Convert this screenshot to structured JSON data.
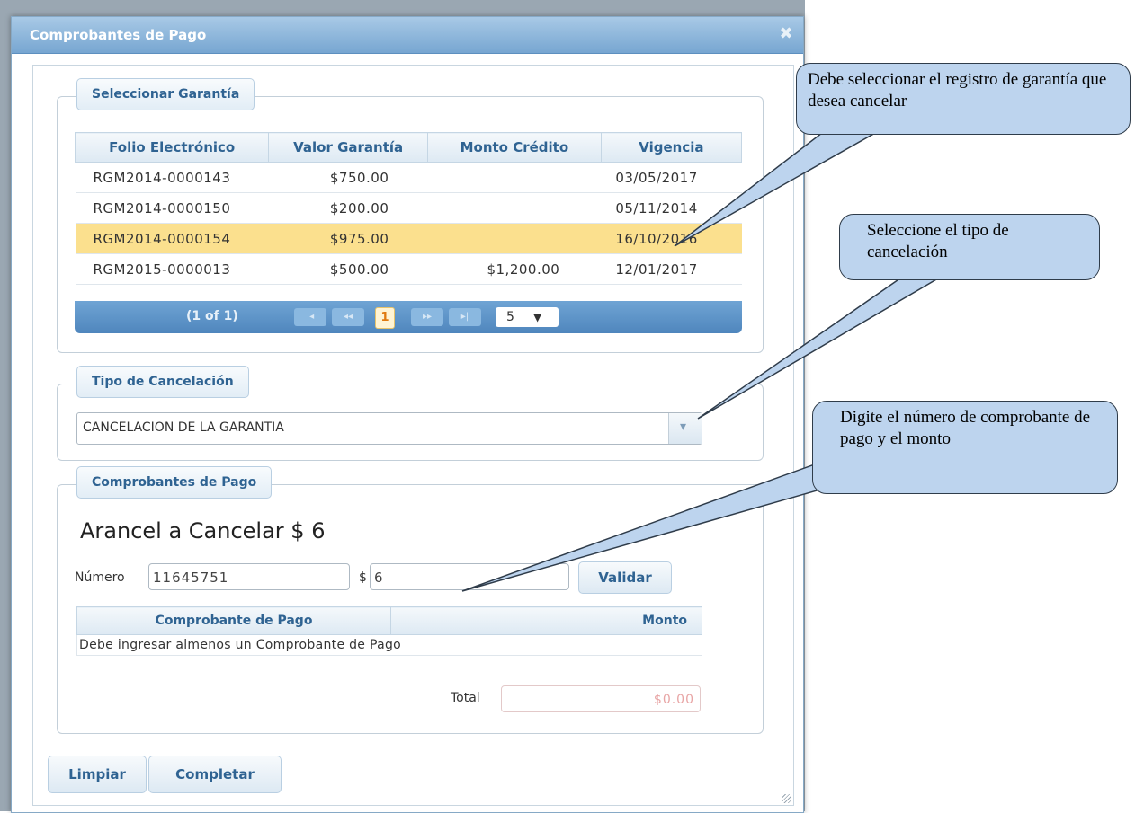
{
  "dialog": {
    "title": "Comprobantes de Pago",
    "close_glyph": "✖"
  },
  "garantia": {
    "legend": "Seleccionar Garantía",
    "columns": [
      "Folio Electrónico",
      "Valor Garantía",
      "Monto Crédito",
      "Vigencia"
    ],
    "rows": [
      {
        "folio": "RGM2014-0000143",
        "valor": "$750.00",
        "monto": "",
        "vigencia": "03/05/2017",
        "selected": false
      },
      {
        "folio": "RGM2014-0000150",
        "valor": "$200.00",
        "monto": "",
        "vigencia": "05/11/2014",
        "selected": false
      },
      {
        "folio": "RGM2014-0000154",
        "valor": "$975.00",
        "monto": "",
        "vigencia": "16/10/2016",
        "selected": true
      },
      {
        "folio": "RGM2015-0000013",
        "valor": "$500.00",
        "monto": "$1,200.00",
        "vigencia": "12/01/2017",
        "selected": false
      }
    ],
    "pager": {
      "info": "(1 of 1)",
      "first": "|◂",
      "prev": "◂◂",
      "current_page": "1",
      "next": "▸▸",
      "last": "▸|",
      "rows_per_page": "5",
      "rows_arrow": "▼"
    }
  },
  "cancelacion": {
    "legend": "Tipo de Cancelación",
    "selected": "CANCELACION DE LA GARANTIA",
    "arrow": "▾"
  },
  "comprobantes": {
    "legend": "Comprobantes de Pago",
    "arancel": "Arancel a Cancelar $ 6",
    "numero_label": "Número",
    "numero_value": "11645751",
    "currency_label": "$",
    "monto_value": "6",
    "validar": "Validar",
    "columns": [
      "Comprobante de Pago",
      "Monto"
    ],
    "empty_message": "Debe ingresar almenos un Comprobante de Pago",
    "total_label": "Total",
    "total_value": "$0.00"
  },
  "actions": {
    "limpiar": "Limpiar",
    "completar": "Completar"
  },
  "callouts": {
    "c1": "Debe seleccionar el registro de garantía que desea cancelar",
    "c2": "Seleccione el tipo de cancelación",
    "c3": "Digite el número de comprobante de pago y el monto"
  }
}
